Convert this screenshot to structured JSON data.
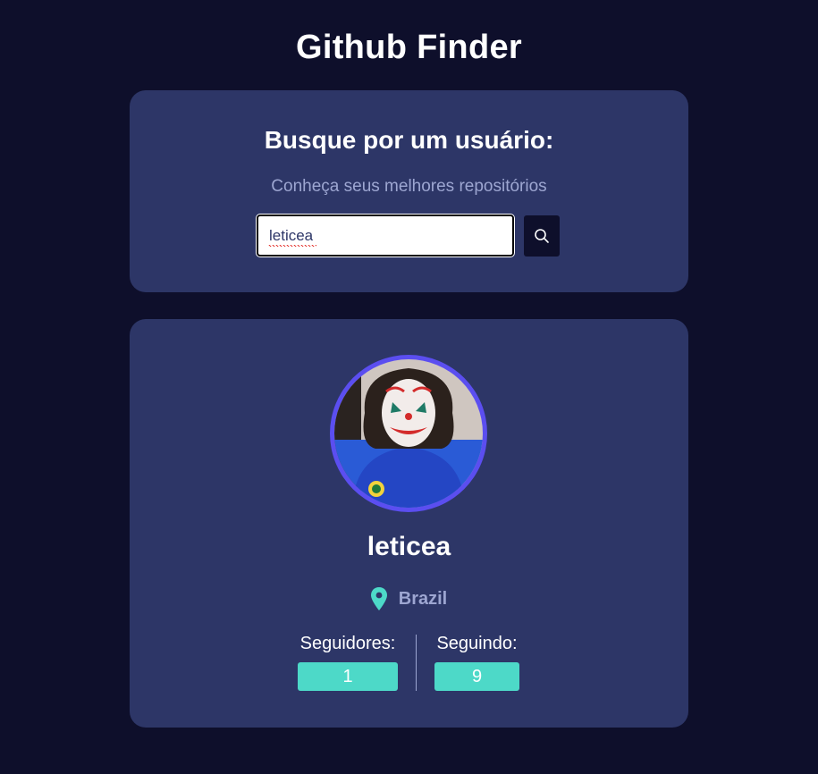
{
  "app": {
    "title": "Github Finder"
  },
  "search": {
    "heading": "Busque por um usuário:",
    "subtitle": "Conheça seus melhores repositórios",
    "value": "leticea",
    "button_icon": "search-icon"
  },
  "profile": {
    "avatar_icon": "avatar",
    "username": "leticea",
    "location_icon": "map-pin-icon",
    "location": "Brazil",
    "followers_label": "Seguidores:",
    "followers": "1",
    "following_label": "Seguindo:",
    "following": "9"
  },
  "colors": {
    "background": "#0e0f2b",
    "card": "#2d3667",
    "accent": "#4dd9c8",
    "avatar_ring": "#5b4ef0",
    "muted_text": "#9da6d1"
  }
}
